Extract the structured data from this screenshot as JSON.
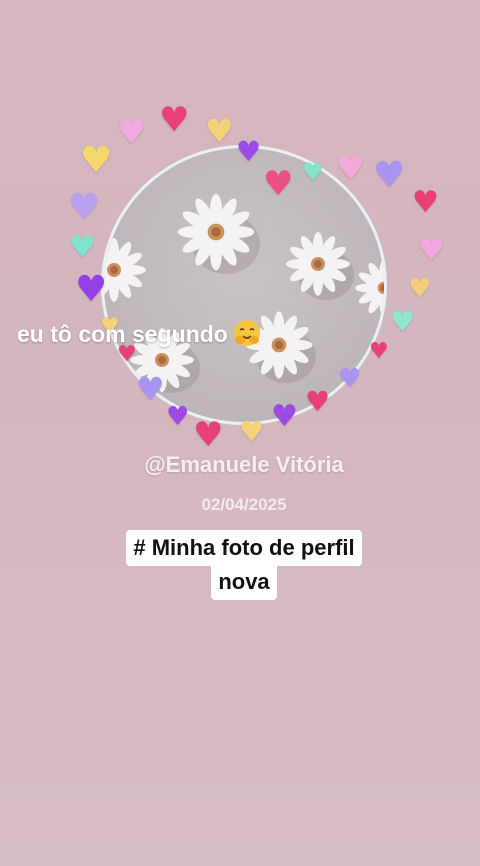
{
  "caption": {
    "text": "eu tô com segundo",
    "emoji_icon": "hugging-face-icon"
  },
  "post": {
    "username": "@Emanuele Vitória",
    "date": "02/04/2025",
    "tag_line1": "# Minha foto de perfil",
    "tag_line2": "nova"
  },
  "avatar": {
    "description_icon": "daisy-flower-icon",
    "border_color": "#e9f1f6"
  },
  "hearts": [
    {
      "color": "#e8417a",
      "icon": "sparkling-heart-icon"
    },
    {
      "color": "#f3a9e2",
      "icon": "pink-heart-icon"
    },
    {
      "color": "#f3d37a",
      "icon": "yellow-heart-icon"
    },
    {
      "color": "#9b4ae3",
      "icon": "purple-heart-icon"
    },
    {
      "color": "#86e3c8",
      "icon": "mint-heart-icon"
    },
    {
      "color": "#a994ef",
      "icon": "lavender-heart-icon"
    }
  ],
  "colors": {
    "background": "#d6b7bf",
    "text_white": "#ffffff",
    "tag_bg": "#ffffff"
  }
}
